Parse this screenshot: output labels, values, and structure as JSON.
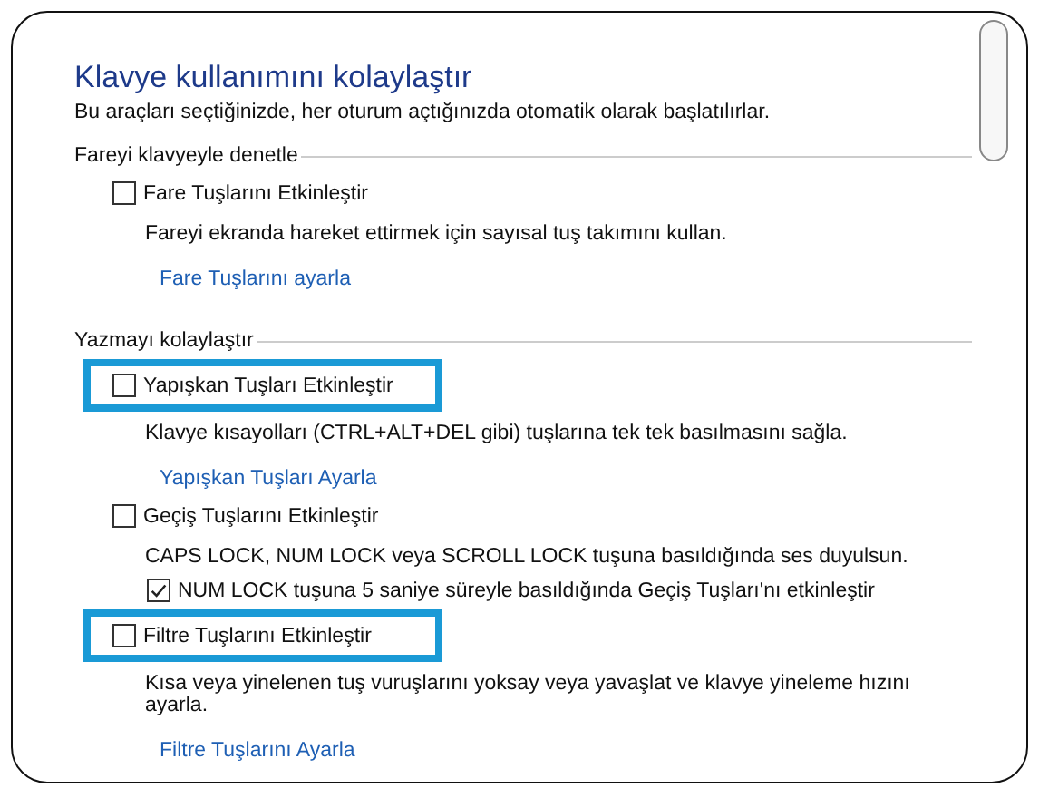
{
  "title": "Klavye kullanımını kolaylaştır",
  "subtitle": "Bu araçları seçtiğinizde, her oturum açtığınızda otomatik olarak başlatılırlar.",
  "sections": [
    {
      "heading": "Fareyi klavyeyle denetle",
      "items": [
        {
          "kind": "checkbox",
          "label": "Fare Tuşlarını Etkinleştir",
          "checked": false,
          "highlighted": false
        },
        {
          "kind": "description",
          "text": "Fareyi ekranda hareket ettirmek için sayısal tuş takımını kullan."
        },
        {
          "kind": "link",
          "text": "Fare Tuşlarını ayarla"
        }
      ]
    },
    {
      "heading": "Yazmayı kolaylaştır",
      "items": [
        {
          "kind": "checkbox",
          "label": "Yapışkan Tuşları Etkinleştir",
          "checked": false,
          "highlighted": true
        },
        {
          "kind": "description",
          "text": "Klavye kısayolları (CTRL+ALT+DEL gibi) tuşlarına tek tek basılmasını sağla."
        },
        {
          "kind": "link",
          "text": "Yapışkan Tuşları Ayarla"
        },
        {
          "kind": "checkbox",
          "label": "Geçiş Tuşlarını Etkinleştir",
          "checked": false,
          "highlighted": false
        },
        {
          "kind": "description",
          "text": "CAPS LOCK, NUM LOCK veya SCROLL LOCK tuşuna basıldığında ses duyulsun."
        },
        {
          "kind": "subcheckbox",
          "label": "NUM LOCK tuşuna 5 saniye süreyle basıldığında Geçiş Tuşları'nı etkinleştir",
          "checked": true
        },
        {
          "kind": "checkbox",
          "label": "Filtre Tuşlarını Etkinleştir",
          "checked": false,
          "highlighted": true
        },
        {
          "kind": "description",
          "text": "Kısa veya yinelenen tuş vuruşlarını yoksay veya yavaşlat ve klavye yineleme hızını ayarla."
        },
        {
          "kind": "link",
          "text": "Filtre Tuşlarını Ayarla"
        }
      ]
    }
  ]
}
